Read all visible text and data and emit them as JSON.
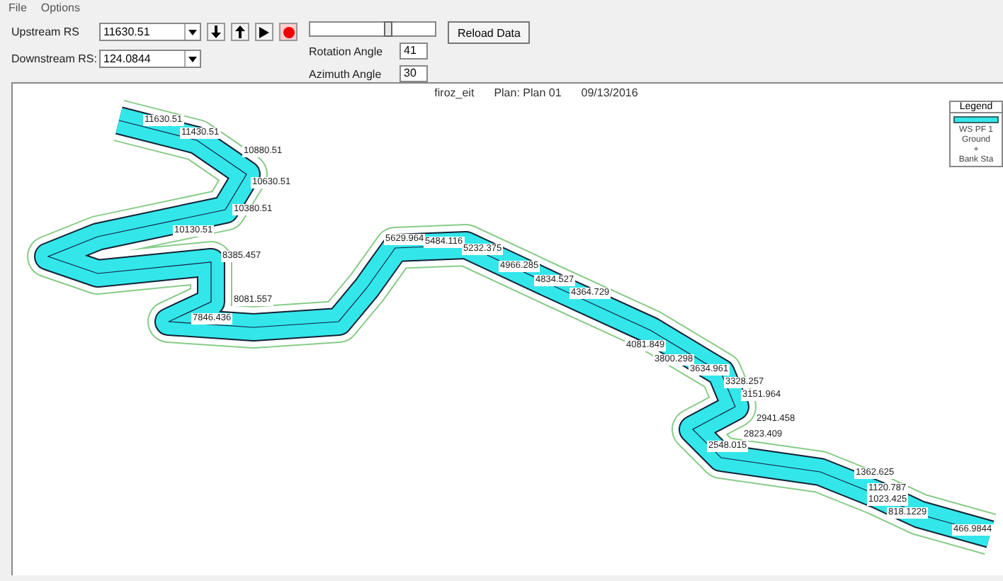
{
  "menu": [
    "File",
    "Options"
  ],
  "toolbar": {
    "upstream_label": "Upstream RS",
    "upstream_value": "11630.51",
    "downstream_label": "Downstream RS:",
    "downstream_value": "124.0844",
    "record_on": true,
    "slider": {
      "level": 0.62
    },
    "rotation_label": "Rotation Angle",
    "rotation_value": "41",
    "azimuth_label": "Azimuth Angle",
    "azimuth_value": "30",
    "reload_button": "Reload Data"
  },
  "plot": {
    "title": [
      "firoz_eit",
      "Plan: Plan 01",
      "09/13/2016"
    ],
    "legend": {
      "title": "Legend",
      "items": [
        {
          "kind": "swatch",
          "label": "WS PF 1",
          "color": "#33e6ea"
        },
        {
          "kind": "text",
          "label": "Ground"
        },
        {
          "kind": "text",
          "label": "+"
        },
        {
          "kind": "text",
          "label": "Bank Sta"
        }
      ]
    },
    "stations": [
      "11630.51",
      "11430.51",
      "10880.51",
      "10630.51",
      "10380.51",
      "10130.51",
      "8385.457",
      "8081.557",
      "7846.436",
      "5629.964",
      "5484.116",
      "5232.375",
      "4966.285",
      "4834.527",
      "4364.729",
      "4081.849",
      "3800.298",
      "3634.961",
      "3328.257",
      "3151.964",
      "2941.458",
      "2823.409",
      "2548.015",
      "1362.625",
      "1120.787",
      "1023.425",
      "818.1229",
      "466.9844"
    ]
  }
}
